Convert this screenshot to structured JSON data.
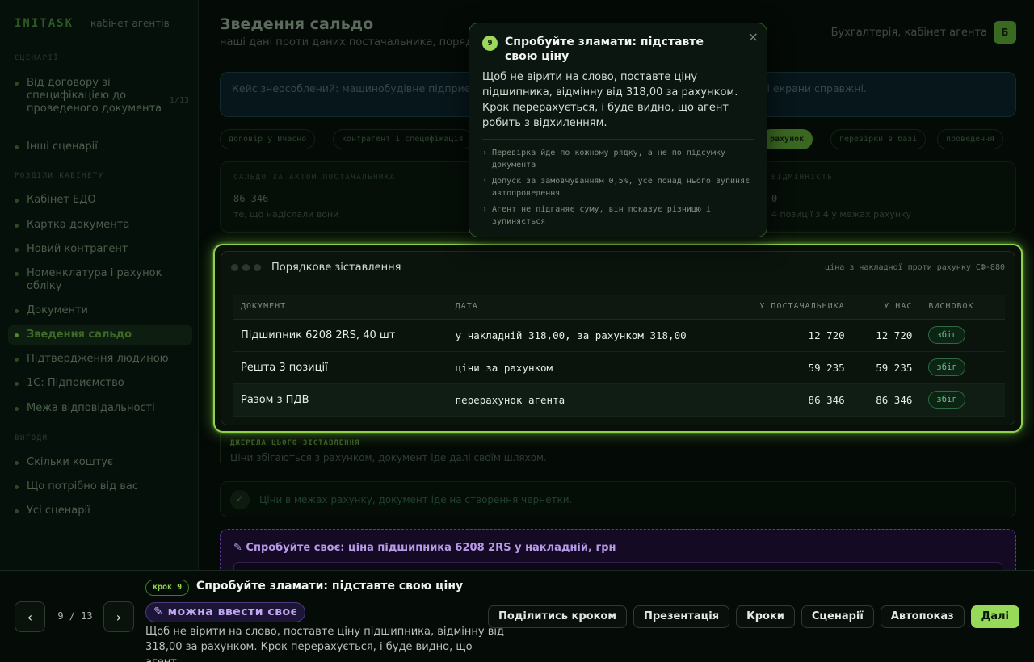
{
  "sidebar": {
    "brand": "INITASK",
    "brand_sub": "кабінет агентів",
    "sections": [
      "СЦЕНАРІЇ",
      "РОЗДІЛИ КАБІНЕТУ",
      "ВИГОДИ"
    ],
    "scenario_items": [
      {
        "label": "Від договору зі специфікацією до проведеного документа",
        "count": "1/13"
      },
      {
        "label": "Інші сценарії"
      }
    ],
    "cabinet_items": [
      {
        "label": "Кабінет ЕДО"
      },
      {
        "label": "Картка документа"
      },
      {
        "label": "Новий контрагент"
      },
      {
        "label": "Номенклатура і рахунок обліку"
      },
      {
        "label": "Документи"
      },
      {
        "label": "Зведення сальдо"
      },
      {
        "label": "Підтвердження людиною"
      },
      {
        "label": "1С: Підприємство"
      },
      {
        "label": "Межа відповідальності"
      }
    ],
    "benefit_items": [
      {
        "label": "Скільки коштує"
      },
      {
        "label": "Що потрібно від вас"
      },
      {
        "label": "Усі сценарії"
      }
    ]
  },
  "main": {
    "title": "Зведення сальдо",
    "subtitle": "наші дані проти даних постачальника, порядо",
    "user_label": "Бухгалтерія, кабінет агента",
    "avatar": "Б",
    "case_text": "Кейс знеособлений: машинобудівне підприємс... ги, номери документів і суми змінені, порядок дій і екрани справжні.",
    "chips": [
      "договір у Вчасно",
      "контрагент і специфікація",
      "рахунок",
      "перевірки в базі",
      "проведення"
    ],
    "saldo": {
      "left_label": "САЛЬДО ЗА АКТОМ ПОСТАЧАЛЬНИКА",
      "left_value": "86 346",
      "left_note": "те, що надіслали вони",
      "right_label": "ВІДМІННІСТЬ",
      "right_value": "0",
      "right_note": "4 позиції з 4 у межах рахунку"
    },
    "sources_title": "ДЖЕРЕЛА ЦЬОГО ЗІСТАВЛЕННЯ",
    "sources_text": "Ціни збігаються з рахунком, документ іде далі своїм шляхом.",
    "status_text": "Ціни в межах рахунку, документ іде на створення чернетки.",
    "try_title": "✎ Спробуйте своє: ціна підшипника 6208 2RS у накладній, грн"
  },
  "card": {
    "title": "Порядкове зіставлення",
    "subtitle": "ціна з накладної проти рахунку СФ-880",
    "columns": [
      "ДОКУМЕНТ",
      "ДАТА",
      "У ПОСТАЧАЛЬНИКА",
      "У НАС",
      "ВИСНОВОК"
    ],
    "rows": [
      {
        "doc": "Підшипник 6208 2RS, 40 шт",
        "date": "у накладній 318,00, за рахунком 318,00",
        "supplier": "12 720",
        "ours": "12 720",
        "verdict": "збіг"
      },
      {
        "doc": "Решта 3 позиції",
        "date": "ціни за рахунком",
        "supplier": "59 235",
        "ours": "59 235",
        "verdict": "збіг"
      },
      {
        "doc": "Разом з ПДВ",
        "date": "перерахунок агента",
        "supplier": "86 346",
        "ours": "86 346",
        "verdict": "збіг"
      }
    ]
  },
  "popover": {
    "step": "9",
    "title": "Спробуйте зламати: підставте свою ціну",
    "close": "×",
    "body": "Щоб не вірити на слово, поставте ціну підшипника, відмінну від 318,00 за рахунком. Крок перерахується, і буде видно, що агент робить з відхиленням.",
    "bullets": [
      "Перевірка йде по кожному рядку, а не по підсумку документа",
      "Допуск за замовчуванням 0,5%, усе понад нього зупиняє автопроведення",
      "Агент не підганяє суму, він показує різницю і зупиняється"
    ]
  },
  "bottombar": {
    "prev": "‹",
    "next": "›",
    "counter": "9 / 13",
    "step_pill": "крок 9",
    "title": "Спробуйте зламати: підставте свою ціну",
    "edit_pill": "✎ можна ввести своє",
    "description": "Щоб не вірити на слово, поставте ціну підшипника, відмінну від 318,00 за рахунком. Крок перерахується, і буде видно, що агент…",
    "actions": [
      "Поділитись кроком",
      "Презентація",
      "Кроки",
      "Сценарії",
      "Автопоказ",
      "Далі"
    ]
  }
}
